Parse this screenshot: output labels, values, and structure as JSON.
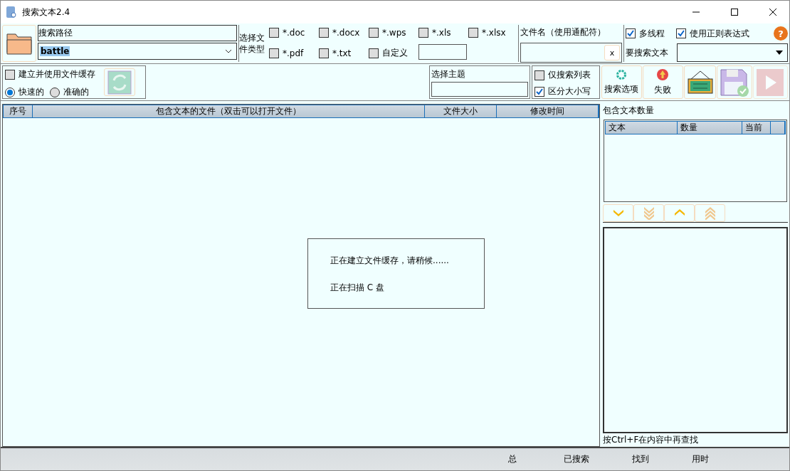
{
  "window": {
    "title": "搜索文本2.4"
  },
  "path": {
    "label": "搜索路径",
    "value": "battle"
  },
  "file_types": {
    "label": "选择文件类型",
    "items": [
      {
        "label": "*.doc",
        "checked": false
      },
      {
        "label": "*.docx",
        "checked": false
      },
      {
        "label": "*.wps",
        "checked": false
      },
      {
        "label": "*.xls",
        "checked": false
      },
      {
        "label": "*.xlsx",
        "checked": false
      },
      {
        "label": "*.pdf",
        "checked": false
      },
      {
        "label": "*.txt",
        "checked": false
      },
      {
        "label": "自定义",
        "checked": false
      }
    ]
  },
  "file_name": {
    "label": "文件名（使用通配符）",
    "clear": "x"
  },
  "options": [
    {
      "label": "多线程",
      "checked": true
    },
    {
      "label": "使用正则表达式",
      "checked": true
    }
  ],
  "search_text": {
    "label": "要搜索文本"
  },
  "help": {
    "label": "?"
  },
  "cache": {
    "label": "建立并使用文件缓存",
    "checked": false
  },
  "modes": [
    {
      "label": "快速的",
      "selected": true
    },
    {
      "label": "准确的",
      "selected": false
    }
  ],
  "theme": {
    "label": "选择主题"
  },
  "filters": [
    {
      "label": "仅搜索列表",
      "checked": false
    },
    {
      "label": "区分大小写",
      "checked": true
    }
  ],
  "toolbar": [
    {
      "kind": "gear",
      "label": "搜索选项"
    },
    {
      "kind": "alert",
      "label": "失败"
    },
    {
      "kind": "open"
    },
    {
      "kind": "save"
    },
    {
      "kind": "play",
      "disabled": true
    }
  ],
  "table": {
    "columns": [
      "序号",
      "包含文本的文件（双击可以打开文件）",
      "文件大小",
      "修改时间"
    ]
  },
  "progress_dialog": {
    "lines": [
      "正在建立文件缓存，请稍候......",
      "正在扫描 C 盘"
    ]
  },
  "counts_panel": {
    "title": "包含文本数量",
    "columns": [
      "文本",
      "数量",
      "当前"
    ],
    "nav": [
      {
        "kind": "down"
      },
      {
        "kind": "down-all"
      },
      {
        "kind": "up"
      },
      {
        "kind": "up-all"
      }
    ],
    "hint": "按Ctrl+F在内容中再查找"
  },
  "status_bar": [
    "总",
    "已搜索",
    "找到",
    "用时"
  ]
}
